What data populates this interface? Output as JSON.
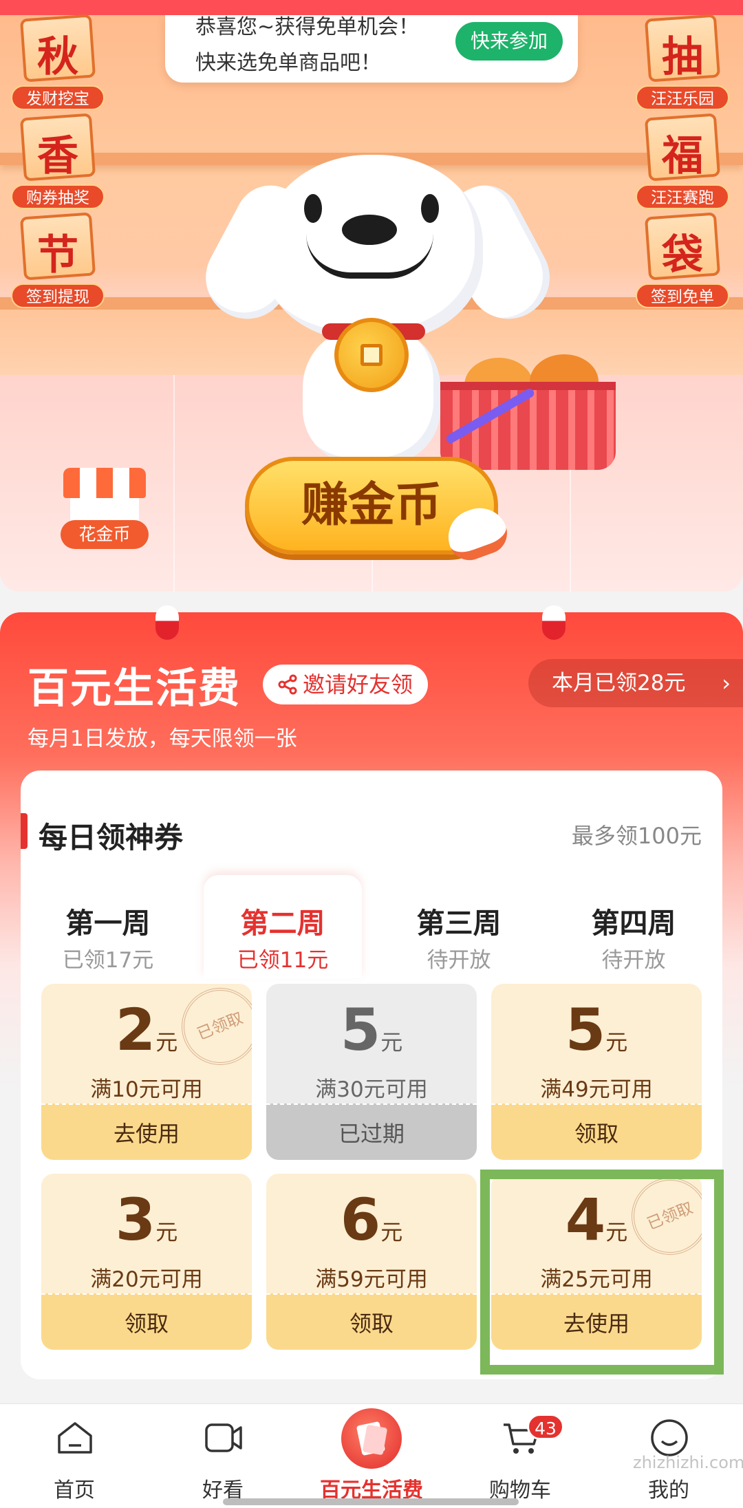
{
  "banner": {
    "notice_line1": "恭喜您~获得免单机会！",
    "notice_line2": "快来选免单商品吧！",
    "notice_button": "快来参加",
    "left_tiles": [
      {
        "char": "秋",
        "caption": "发财挖宝"
      },
      {
        "char": "香",
        "caption": "购券抽奖"
      },
      {
        "char": "节",
        "caption": "签到提现"
      }
    ],
    "right_tiles": [
      {
        "char": "抽",
        "caption": "汪汪乐园"
      },
      {
        "char": "福",
        "caption": "汪汪赛跑"
      },
      {
        "char": "袋",
        "caption": "签到免单"
      }
    ],
    "earn_button": "赚金币",
    "spend_label": "花金币"
  },
  "life": {
    "title": "百元生活费",
    "invite_button": "邀请好友领",
    "month_tag": "本月已领28元",
    "rule": "每月1日发放，每天限领一张"
  },
  "daily": {
    "title": "每日领神券",
    "max": "最多领100元",
    "weeks": [
      {
        "name": "第一周",
        "sub": "已领17元"
      },
      {
        "name": "第二周",
        "sub": "已领11元"
      },
      {
        "name": "第三周",
        "sub": "待开放"
      },
      {
        "name": "第四周",
        "sub": "待开放"
      }
    ],
    "unit": "元",
    "stamp": "已领取",
    "coupons": [
      {
        "amount": "2",
        "condition": "满10元可用",
        "action": "去使用"
      },
      {
        "amount": "5",
        "condition": "满30元可用",
        "action": "已过期"
      },
      {
        "amount": "5",
        "condition": "满49元可用",
        "action": "领取"
      },
      {
        "amount": "3",
        "condition": "满20元可用",
        "action": "领取"
      },
      {
        "amount": "6",
        "condition": "满59元可用",
        "action": "领取"
      },
      {
        "amount": "4",
        "condition": "满25元可用",
        "action": "去使用"
      }
    ]
  },
  "nav": {
    "items": [
      {
        "label": "首页",
        "icon": "home-icon"
      },
      {
        "label": "好看",
        "icon": "video-icon"
      },
      {
        "label": "百元生活费",
        "icon": "red-envelope-icon"
      },
      {
        "label": "购物车",
        "icon": "cart-icon"
      },
      {
        "label": "我的",
        "icon": "profile-icon"
      }
    ],
    "cart_badge": "43"
  },
  "watermark": "zhizhizhi.com",
  "colors": {
    "accent": "#e4322f",
    "coupon": "#fdefd4",
    "highlight": "#7cb85a",
    "notice_button": "#1db36a"
  }
}
